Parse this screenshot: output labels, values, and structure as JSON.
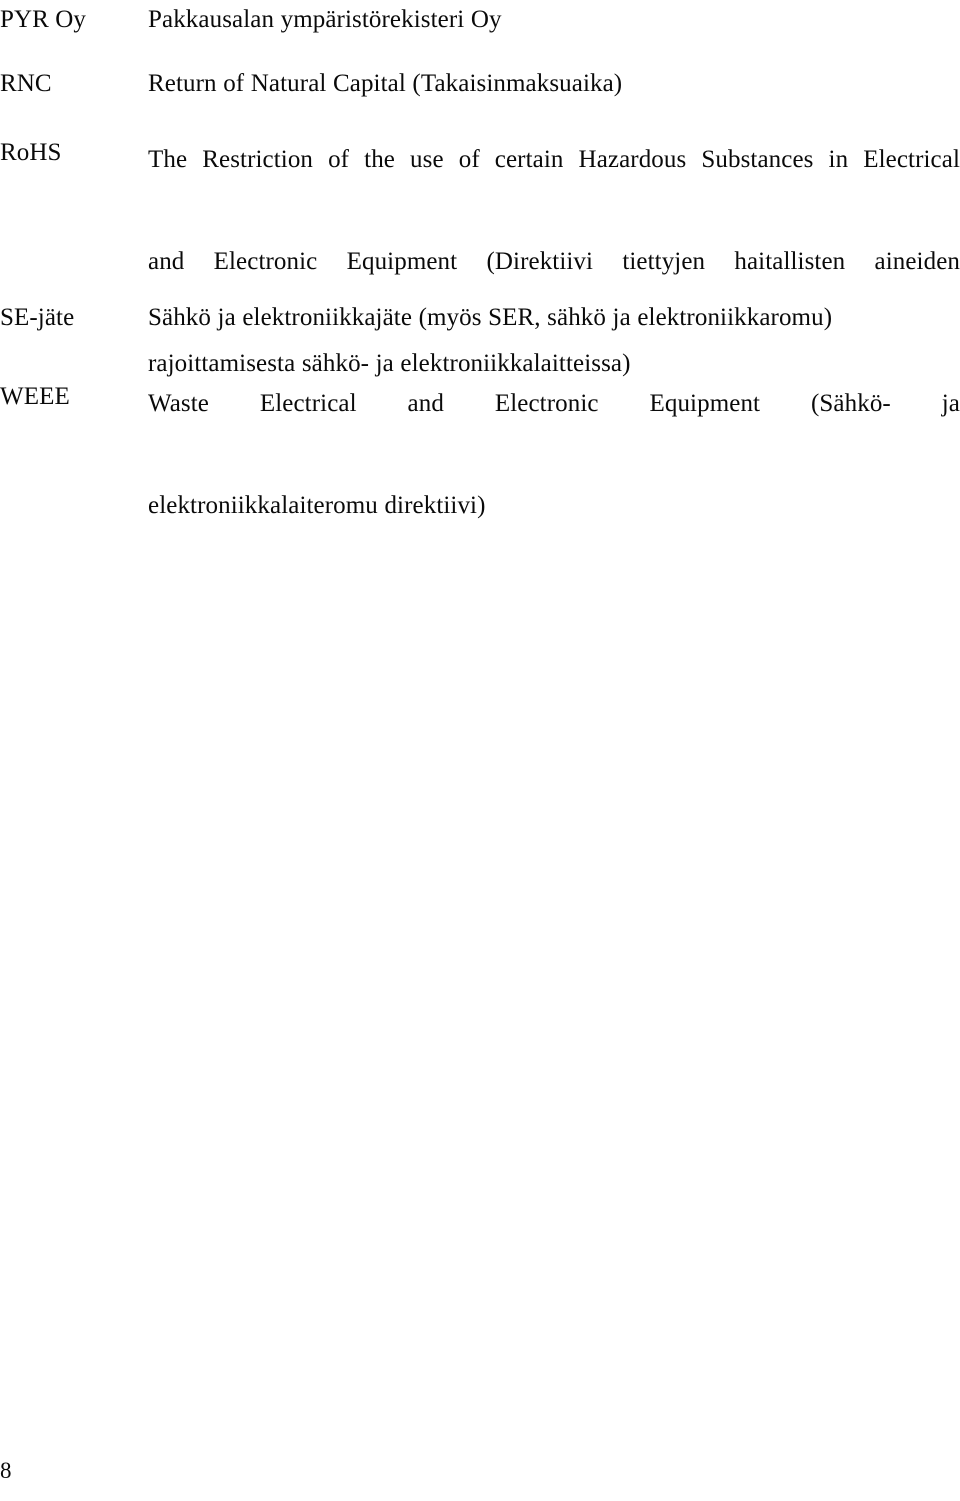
{
  "document": {
    "page_number": "8",
    "entries": [
      {
        "term": "PYR Oy",
        "definition": "Pakkausalan ympäristörekisteri Oy",
        "lines": [
          "Pakkausalan ympäristörekisteri Oy"
        ]
      },
      {
        "term": "RNC",
        "definition": "Return of Natural Capital (Takaisinmaksuaika)",
        "lines": [
          "Return of Natural Capital (Takaisinmaksuaika)"
        ]
      },
      {
        "term": "RoHS",
        "definition": "The Restriction of the use of certain Hazardous Substances in Electrical and Electronic Equipment (Direktiivi tiettyjen haitallisten aineiden rajoittamisesta sähkö- ja elektroniikkalaitteissa)",
        "lines": [
          "The Restriction of the use of certain Hazardous Substances in Electrical",
          "and Electronic Equipment (Direktiivi tiettyjen haitallisten aineiden",
          "rajoittamisesta sähkö- ja elektroniikkalaitteissa)"
        ]
      },
      {
        "term": "SE-jäte",
        "definition": "Sähkö ja elektroniikkajäte (myös SER, sähkö ja elektroniikkaromu)",
        "lines": [
          "Sähkö ja elektroniikkajäte (myös SER, sähkö ja elektroniikkaromu)"
        ]
      },
      {
        "term": "WEEE",
        "definition": "Waste Electrical and Electronic Equipment (Sähkö- ja elektroniikkalaiteromu direktiivi)",
        "lines": [
          "Waste Electrical and Electronic Equipment (Sähkö- ja",
          "elektroniikkalaiteromu direktiivi)"
        ]
      }
    ]
  }
}
